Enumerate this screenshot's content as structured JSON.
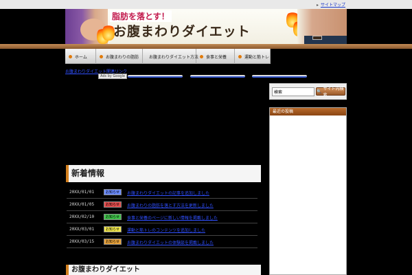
{
  "top": {
    "link": "サイトマップ"
  },
  "header": {
    "tagline": "脂肪を落とす！",
    "site_name": "お腹まわりダイエット"
  },
  "nav": {
    "items": [
      {
        "label": "ホーム"
      },
      {
        "label": "お腹まわりの脂肪"
      },
      {
        "label": "お腹まわりダイエット方法"
      },
      {
        "label": "食事と栄養"
      },
      {
        "label": "運動と筋トレ"
      }
    ]
  },
  "ads": {
    "link": "お腹まわりダイエット関連リンク",
    "adsby": "Ads by Google"
  },
  "search": {
    "value": "検索",
    "button": "サイト内検索"
  },
  "sidebar": {
    "widget_title": "最近の投稿"
  },
  "news": {
    "heading": "新着情報",
    "rows": [
      {
        "date": "20XX/01/01",
        "badge": "お知らせ",
        "title": "お腹まわりダイエットの記事を追加しました",
        "color": "#6b8cff"
      },
      {
        "date": "20XX/01/05",
        "badge": "お知らせ",
        "title": "お腹まわりの脂肪を落とす方法を更新しました",
        "color": "#e24a4a"
      },
      {
        "date": "20XX/02/10",
        "badge": "お知らせ",
        "title": "食事と栄養のページに新しい情報を掲載しました",
        "color": "#3fc24a"
      },
      {
        "date": "20XX/03/01",
        "badge": "お知らせ",
        "title": "運動と筋トレのコンテンツを追加しました",
        "color": "#f0e64a"
      },
      {
        "date": "20XX/03/15",
        "badge": "お知らせ",
        "title": "お腹まわりダイエットの体験談を掲載しました",
        "color": "#e8a23a"
      }
    ]
  },
  "bottom": {
    "heading": "お腹まわりダイエット"
  }
}
